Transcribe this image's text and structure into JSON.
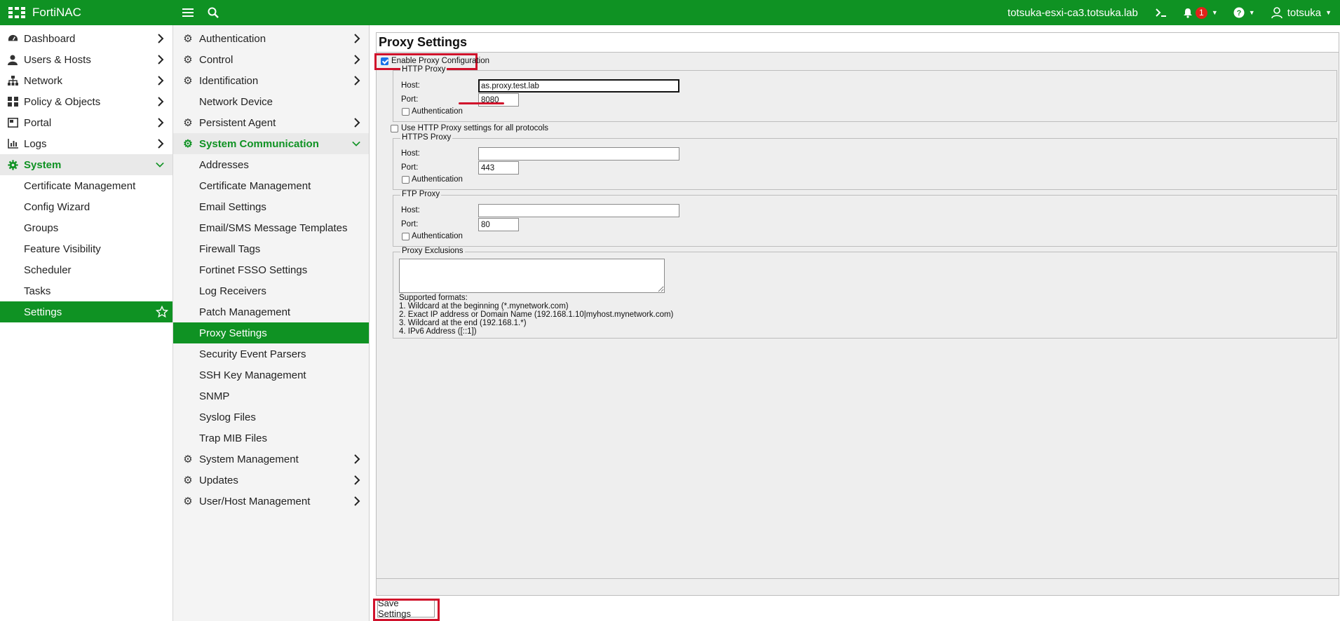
{
  "header": {
    "app_name": "FortiNAC",
    "hostname": "totsuka-esxi-ca3.totsuka.lab",
    "notification_count": "1",
    "username": "totsuka",
    "brand_color": "#0f9223",
    "icons": [
      "fortinac-logo-icon",
      "hamburger-menu-icon",
      "search-icon",
      "terminal-icon",
      "bell-icon",
      "help-icon",
      "user-icon"
    ]
  },
  "nav_primary": [
    {
      "label": "Dashboard",
      "icon": "dashboard-icon"
    },
    {
      "label": "Users & Hosts",
      "icon": "user-icon"
    },
    {
      "label": "Network",
      "icon": "network-icon"
    },
    {
      "label": "Policy & Objects",
      "icon": "policy-icon"
    },
    {
      "label": "Portal",
      "icon": "portal-icon"
    },
    {
      "label": "Logs",
      "icon": "logs-icon"
    },
    {
      "label": "System",
      "icon": "gear-icon"
    },
    {
      "label": "Certificate Management"
    },
    {
      "label": "Config Wizard"
    },
    {
      "label": "Groups"
    },
    {
      "label": "Feature Visibility"
    },
    {
      "label": "Scheduler"
    },
    {
      "label": "Tasks"
    },
    {
      "label": "Settings"
    }
  ],
  "nav_secondary": [
    {
      "label": "Authentication"
    },
    {
      "label": "Control"
    },
    {
      "label": "Identification"
    },
    {
      "label": "Network Device"
    },
    {
      "label": "Persistent Agent"
    },
    {
      "label": "System Communication"
    },
    {
      "label": "Addresses"
    },
    {
      "label": "Certificate Management"
    },
    {
      "label": "Email Settings"
    },
    {
      "label": "Email/SMS Message Templates"
    },
    {
      "label": "Firewall Tags"
    },
    {
      "label": "Fortinet FSSO Settings"
    },
    {
      "label": "Log Receivers"
    },
    {
      "label": "Patch Management"
    },
    {
      "label": "Proxy Settings"
    },
    {
      "label": "Security Event Parsers"
    },
    {
      "label": "SSH Key Management"
    },
    {
      "label": "SNMP"
    },
    {
      "label": "Syslog Files"
    },
    {
      "label": "Trap MIB Files"
    },
    {
      "label": "System Management"
    },
    {
      "label": "Updates"
    },
    {
      "label": "User/Host Management"
    }
  ],
  "proxy": {
    "title": "Proxy Settings",
    "enable_label": "Enable Proxy Configuration",
    "enable_checked": true,
    "http": {
      "legend": "HTTP Proxy",
      "host_label": "Host:",
      "host_value": "as.proxy.test.lab",
      "port_label": "Port:",
      "port_value": "8080",
      "auth_label": "Authentication"
    },
    "use_http_all_label": "Use HTTP Proxy settings for all protocols",
    "https": {
      "legend": "HTTPS Proxy",
      "host_label": "Host:",
      "host_value": "",
      "port_label": "Port:",
      "port_value": "443",
      "auth_label": "Authentication"
    },
    "ftp": {
      "legend": "FTP Proxy",
      "host_label": "Host:",
      "host_value": "",
      "port_label": "Port:",
      "port_value": "80",
      "auth_label": "Authentication"
    },
    "exclusions": {
      "legend": "Proxy Exclusions",
      "value": "",
      "formats_title": "Supported formats:",
      "formats": [
        "1. Wildcard at the beginning (*.mynetwork.com)",
        "2. Exact IP address or Domain Name (192.168.1.10|myhost.mynetwork.com)",
        "3. Wildcard at the end (192.168.1.*)",
        "4. IPv6 Address ([::1])"
      ]
    },
    "save_label": "Save Settings",
    "highlight_color": "#d0112b"
  }
}
